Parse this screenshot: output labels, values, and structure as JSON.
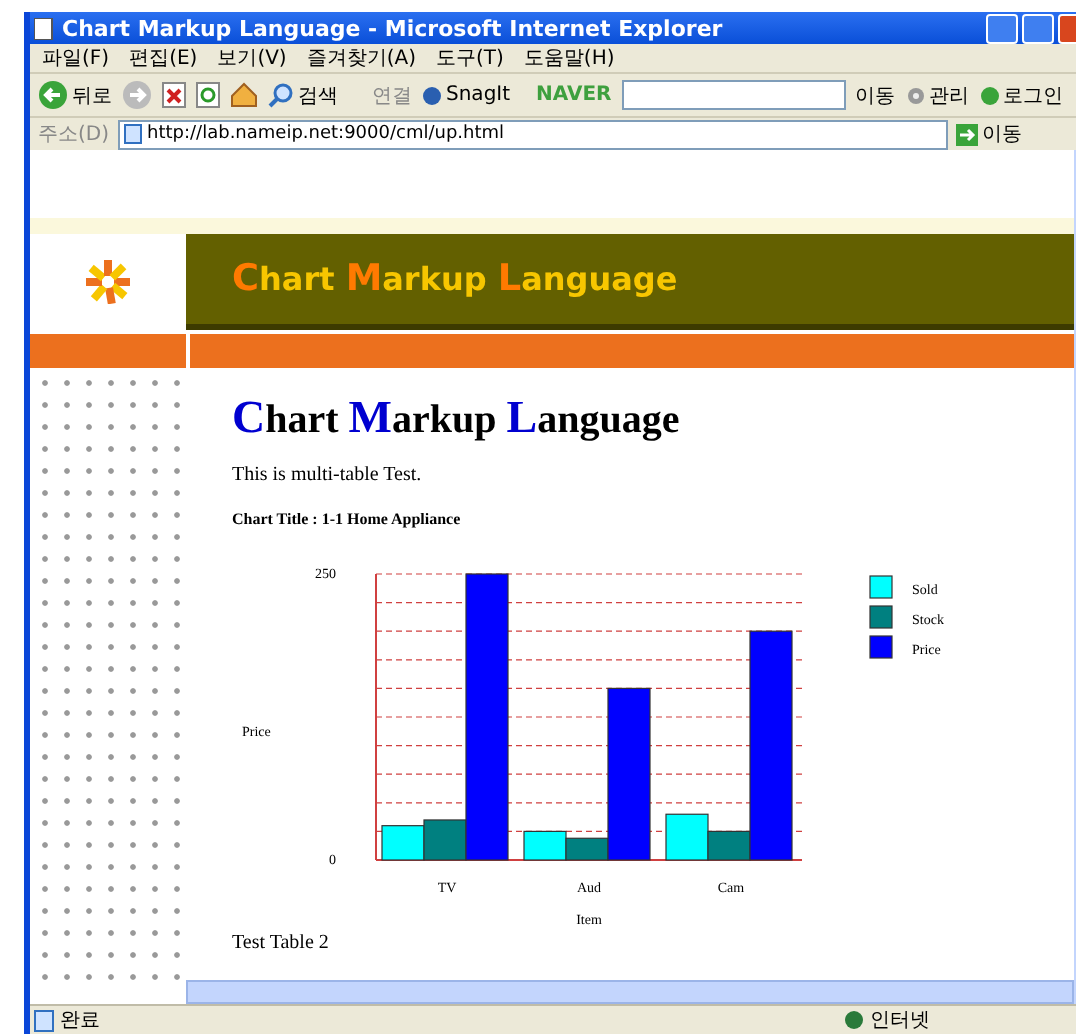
{
  "window": {
    "title": "Chart Markup Language - Microsoft Internet Explorer"
  },
  "menu": [
    "파일(F)",
    "편집(E)",
    "보기(V)",
    "즐겨찾기(A)",
    "도구(T)",
    "도움말(H)"
  ],
  "toolbar": {
    "back": "뒤로",
    "search": "검색",
    "links": "연결",
    "snagit": "SnagIt",
    "naver": "NAVER",
    "go": "이동",
    "manage": "관리",
    "login": "로그인"
  },
  "address": {
    "label": "주소(D)",
    "url": "http://lab.nameip.net:9000/cml/up.html",
    "go": "이동"
  },
  "banner": {
    "title_words": [
      "Chart",
      "Markup",
      "Language"
    ]
  },
  "content": {
    "heading_words": [
      "Chart",
      "Markup",
      "Language"
    ],
    "intro": "This is multi-table Test.",
    "chart_title": "Chart Title : 1-1 Home Appliance",
    "chart_data": {
      "type": "bar",
      "xlabel": "Item",
      "ylabel": "Price",
      "categories": [
        "TV",
        "Aud",
        "Cam"
      ],
      "ylim": [
        0,
        250
      ],
      "yticks": [
        0,
        250
      ],
      "ref_lines": [
        {
          "axis": "y",
          "value": 25
        },
        {
          "axis": "y",
          "value": 50
        },
        {
          "axis": "y",
          "value": 75
        },
        {
          "axis": "y",
          "value": 100
        },
        {
          "axis": "y",
          "value": 125
        },
        {
          "axis": "y",
          "value": 150
        },
        {
          "axis": "y",
          "value": 175
        },
        {
          "axis": "y",
          "value": 200
        },
        {
          "axis": "y",
          "value": 225
        },
        {
          "axis": "y",
          "value": 250
        }
      ],
      "legend": true,
      "series": [
        {
          "name": "Sold",
          "color": "#00ffff",
          "values": [
            30,
            25,
            40
          ]
        },
        {
          "name": "Stock",
          "color": "#008080",
          "values": [
            35,
            19,
            25
          ]
        },
        {
          "name": "Price",
          "color": "#0000ff",
          "values": [
            250,
            150,
            200
          ]
        }
      ]
    },
    "next_title": "Test Table 2"
  },
  "status_bar": {
    "text": "완료",
    "zone": "인터넷"
  }
}
